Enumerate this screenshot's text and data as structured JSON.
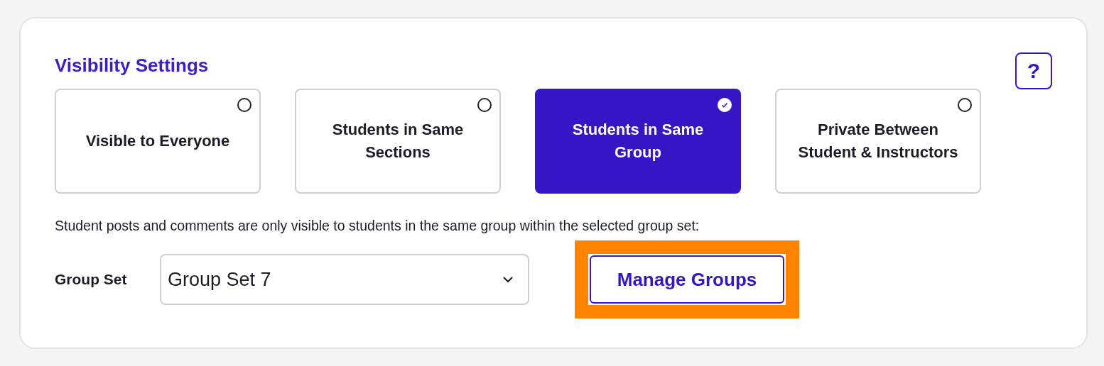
{
  "section": {
    "title": "Visibility Settings",
    "help_button": "?"
  },
  "options": [
    {
      "label": "Visible to Everyone",
      "selected": false
    },
    {
      "label": "Students in Same Sections",
      "selected": false
    },
    {
      "label": "Students in Same Group",
      "selected": true
    },
    {
      "label": "Private Between Student & Instructors",
      "selected": false
    }
  ],
  "description": "Student posts and comments are only visible to students in the same group within the selected group set:",
  "group_set": {
    "label": "Group Set",
    "value": "Group Set 7"
  },
  "manage_button": {
    "label": "Manage Groups",
    "highlighted": true
  }
}
